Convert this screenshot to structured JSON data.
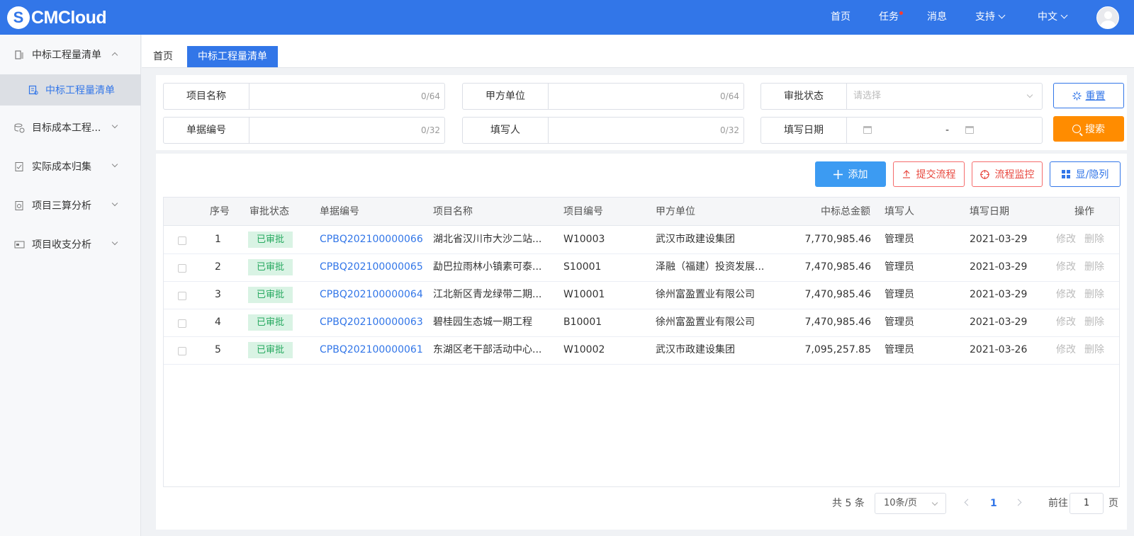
{
  "brand": {
    "mark": "S",
    "name": "CMCloud"
  },
  "topnav": {
    "home": "首页",
    "tasks": "任务",
    "messages": "消息",
    "support": "支持",
    "language": "中文"
  },
  "sidebar": {
    "items": [
      {
        "label": "中标工程量清单",
        "icon": "document-icon"
      },
      {
        "label": "目标成本工程...",
        "icon": "coins-icon"
      },
      {
        "label": "实际成本归集",
        "icon": "checklist-icon"
      },
      {
        "label": "项目三算分析",
        "icon": "report-icon"
      },
      {
        "label": "项目收支分析",
        "icon": "wallet-icon"
      }
    ],
    "sub_active": "中标工程量清单"
  },
  "tabs": {
    "home": "首页",
    "active": "中标工程量清单"
  },
  "filters": {
    "project_name": {
      "label": "项目名称",
      "count": "0/64"
    },
    "party_a": {
      "label": "甲方单位",
      "count": "0/64"
    },
    "approval_status": {
      "label": "审批状态",
      "placeholder": "请选择"
    },
    "doc_no": {
      "label": "单据编号",
      "count": "0/32"
    },
    "filler": {
      "label": "填写人",
      "count": "0/32"
    },
    "fill_date": {
      "label": "填写日期",
      "separator": "-"
    },
    "reset": "重置",
    "search": "搜索"
  },
  "actions": {
    "add": "添加",
    "submit_flow": "提交流程",
    "flow_monitor": "流程监控",
    "toggle_columns": "显/隐列"
  },
  "table": {
    "headers": [
      "序号",
      "审批状态",
      "单据编号",
      "项目名称",
      "项目编号",
      "甲方单位",
      "中标总金额",
      "填写人",
      "填写日期",
      "操作"
    ],
    "rows": [
      {
        "index": "1",
        "status": "已审批",
        "doc_no": "CPBQ202100000066",
        "project": "湖北省汉川市大沙二站...",
        "project_no": "W10003",
        "party_a": "武汉市政建设集团",
        "amount": "7,770,985.46",
        "filler": "管理员",
        "date": "2021-03-29",
        "edit": "修改",
        "delete": "删除"
      },
      {
        "index": "2",
        "status": "已审批",
        "doc_no": "CPBQ202100000065",
        "project": "勐巴拉雨林小镇素可泰...",
        "project_no": "S10001",
        "party_a": "泽融（福建）投资发展...",
        "amount": "7,470,985.46",
        "filler": "管理员",
        "date": "2021-03-29",
        "edit": "修改",
        "delete": "删除"
      },
      {
        "index": "3",
        "status": "已审批",
        "doc_no": "CPBQ202100000064",
        "project": "江北新区青龙绿带二期...",
        "project_no": "W10001",
        "party_a": "徐州富盈置业有限公司",
        "amount": "7,470,985.46",
        "filler": "管理员",
        "date": "2021-03-29",
        "edit": "修改",
        "delete": "删除"
      },
      {
        "index": "4",
        "status": "已审批",
        "doc_no": "CPBQ202100000063",
        "project": "碧桂园生态城一期工程",
        "project_no": "B10001",
        "party_a": "徐州富盈置业有限公司",
        "amount": "7,470,985.46",
        "filler": "管理员",
        "date": "2021-03-29",
        "edit": "修改",
        "delete": "删除"
      },
      {
        "index": "5",
        "status": "已审批",
        "doc_no": "CPBQ202100000061",
        "project": "东湖区老干部活动中心...",
        "project_no": "W10002",
        "party_a": "武汉市政建设集团",
        "amount": "7,095,257.85",
        "filler": "管理员",
        "date": "2021-03-26",
        "edit": "修改",
        "delete": "删除"
      }
    ]
  },
  "pagination": {
    "total": "共 5 条",
    "page_size": "10条/页",
    "current": "1",
    "goto_prefix": "前往",
    "goto_value": "1",
    "goto_suffix": "页"
  },
  "colors": {
    "primary": "#3276e8",
    "orange": "#ff8c00",
    "danger": "#e8483f",
    "success": "#27a960"
  }
}
